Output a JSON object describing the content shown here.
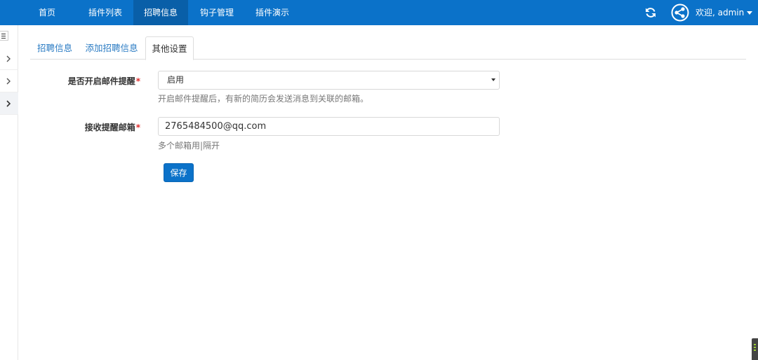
{
  "navbar": {
    "items": [
      {
        "label": "首页"
      },
      {
        "label": "插件列表"
      },
      {
        "label": "招聘信息"
      },
      {
        "label": "钩子管理"
      },
      {
        "label": "插件演示"
      }
    ],
    "active_index": 2,
    "refresh_icon": "refresh-icon",
    "avatar_icon": "share-network-icon",
    "user_label": "欢迎, admin"
  },
  "sidebar": {
    "toggle_icon": "menu-list-icon",
    "items": [
      {
        "icon": "chevron-right-icon"
      },
      {
        "icon": "chevron-right-icon"
      },
      {
        "icon": "chevron-right-icon"
      }
    ]
  },
  "tabs": [
    {
      "label": "招聘信息"
    },
    {
      "label": "添加招聘信息"
    },
    {
      "label": "其他设置"
    }
  ],
  "active_tab": 2,
  "form": {
    "email_alert": {
      "label": "是否开启邮件提醒",
      "required_mark": "*",
      "selected": "启用",
      "help": "开启邮件提醒后，有新的简历会发送消息到关联的邮箱。"
    },
    "receive_email": {
      "label": "接收提醒邮箱",
      "required_mark": "*",
      "value": "2765484500@qq.com",
      "help": "多个邮箱用|隔开"
    },
    "save_label": "保存"
  },
  "colors": {
    "navbar": "#0b72c9",
    "navbar_active": "#095fa8",
    "link": "#2a7bc3",
    "required": "#e02b2b"
  }
}
